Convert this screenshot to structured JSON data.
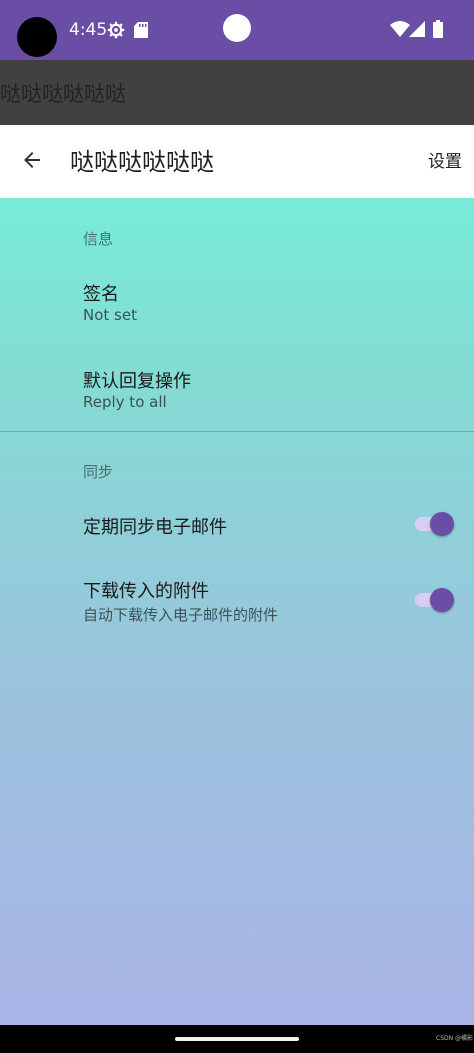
{
  "status_bar": {
    "time": "4:45",
    "icons": [
      "settings-gear-icon",
      "sd-card-icon",
      "wifi-icon",
      "cell-signal-icon",
      "battery-icon"
    ],
    "color": "#6a4ea5"
  },
  "dark_header": {
    "title": "哒哒哒哒哒哒"
  },
  "app_bar": {
    "title": "哒哒哒哒哒哒",
    "back_icon": "arrow-back-icon",
    "action_label": "设置"
  },
  "sections": [
    {
      "header": "信息",
      "items": [
        {
          "title": "签名",
          "summary": "Not set"
        },
        {
          "title": "默认回复操作",
          "summary": "Reply to all"
        }
      ]
    },
    {
      "header": "同步",
      "items": [
        {
          "title": "定期同步电子邮件",
          "switch_on": true
        },
        {
          "title": "下载传入的附件",
          "summary": "自动下载传入电子邮件的附件",
          "switch_on": true
        }
      ]
    }
  ],
  "watermark": "CSDN @橘影",
  "colors": {
    "accent": "#6a4ea5",
    "gradient_top": "#78ebd7",
    "gradient_bottom": "#a9b3e6"
  }
}
